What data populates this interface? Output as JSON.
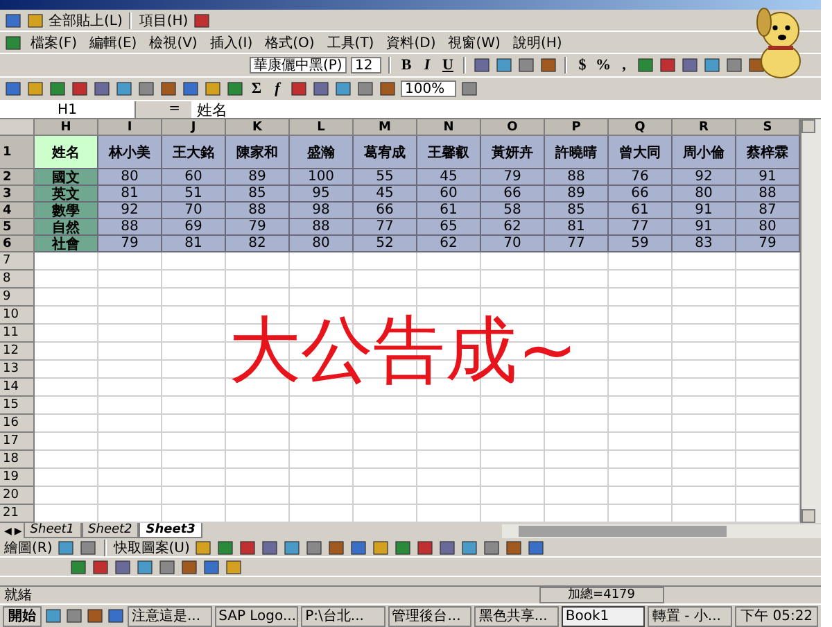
{
  "clipboard_bar": {
    "items": [
      "全部貼上(L)",
      "項目(H)"
    ]
  },
  "menu": [
    "檔案(F)",
    "編輯(E)",
    "檢視(V)",
    "插入(I)",
    "格式(O)",
    "工具(T)",
    "資料(D)",
    "視窗(W)",
    "說明(H)"
  ],
  "format_toolbar": {
    "font": "華康儷中黑(P)",
    "size": "12",
    "style_buttons": [
      "B",
      "I",
      "U"
    ],
    "number_buttons": [
      "$",
      "%",
      ","
    ]
  },
  "standard_toolbar": {
    "symbols": [
      "Σ",
      "f"
    ],
    "zoom": "100%"
  },
  "formula_bar": {
    "name_box": "H1",
    "equals": "=",
    "content": "姓名"
  },
  "sheet": {
    "columns": [
      {
        "label": "H",
        "selected": true
      },
      {
        "label": "I",
        "selected": true
      },
      {
        "label": "J",
        "selected": true
      },
      {
        "label": "K",
        "selected": true
      },
      {
        "label": "L",
        "selected": true
      },
      {
        "label": "M",
        "selected": true
      },
      {
        "label": "N",
        "selected": true
      },
      {
        "label": "O",
        "selected": true
      },
      {
        "label": "P",
        "selected": true
      },
      {
        "label": "Q",
        "selected": true
      },
      {
        "label": "R",
        "selected": true
      },
      {
        "label": "S",
        "selected": true
      }
    ],
    "rows": [
      {
        "number": "1",
        "selected": true,
        "cells": [
          "姓名",
          "林小美",
          "王大銘",
          "陳家和",
          "盛瀚",
          "葛宥成",
          "王馨叡",
          "黃妍卉",
          "許曉晴",
          "曾大同",
          "周小倫",
          "蔡梓霖"
        ]
      },
      {
        "number": "2",
        "selected": true,
        "cells": [
          "國文",
          "80",
          "60",
          "89",
          "100",
          "55",
          "45",
          "79",
          "88",
          "76",
          "92",
          "91"
        ]
      },
      {
        "number": "3",
        "selected": true,
        "cells": [
          "英文",
          "81",
          "51",
          "85",
          "95",
          "45",
          "60",
          "66",
          "89",
          "66",
          "80",
          "88"
        ]
      },
      {
        "number": "4",
        "selected": true,
        "cells": [
          "數學",
          "92",
          "70",
          "88",
          "98",
          "66",
          "61",
          "58",
          "85",
          "61",
          "91",
          "87"
        ]
      },
      {
        "number": "5",
        "selected": true,
        "cells": [
          "自然",
          "88",
          "69",
          "79",
          "88",
          "77",
          "65",
          "62",
          "81",
          "77",
          "91",
          "80"
        ]
      },
      {
        "number": "6",
        "selected": true,
        "cells": [
          "社會",
          "79",
          "81",
          "82",
          "80",
          "52",
          "62",
          "70",
          "77",
          "59",
          "83",
          "79"
        ]
      },
      {
        "number": "7",
        "selected": false,
        "cells": []
      },
      {
        "number": "8",
        "selected": false,
        "cells": []
      },
      {
        "number": "9",
        "selected": false,
        "cells": []
      },
      {
        "number": "10",
        "selected": false,
        "cells": []
      },
      {
        "number": "11",
        "selected": false,
        "cells": []
      },
      {
        "number": "12",
        "selected": false,
        "cells": []
      },
      {
        "number": "13",
        "selected": false,
        "cells": []
      },
      {
        "number": "14",
        "selected": false,
        "cells": []
      },
      {
        "number": "15",
        "selected": false,
        "cells": []
      },
      {
        "number": "16",
        "selected": false,
        "cells": []
      },
      {
        "number": "17",
        "selected": false,
        "cells": []
      },
      {
        "number": "18",
        "selected": false,
        "cells": []
      },
      {
        "number": "19",
        "selected": false,
        "cells": []
      },
      {
        "number": "20",
        "selected": false,
        "cells": []
      },
      {
        "number": "21",
        "selected": false,
        "cells": []
      }
    ],
    "overlay_text": "大公告成~"
  },
  "sheet_nav": [
    "◀",
    "▶"
  ],
  "sheet_tabs": [
    {
      "label": "Sheet1",
      "selected": false
    },
    {
      "label": "Sheet2",
      "selected": false
    },
    {
      "label": "Sheet3",
      "selected": true
    }
  ],
  "drawing_toolbar": {
    "draw_menu": "繪圖(R)",
    "autoshapes_menu": "快取圖案(U)"
  },
  "status_bar": {
    "mode": "就緒",
    "sum": "加總=4179"
  },
  "taskbar": {
    "start": "開始",
    "tasks": [
      {
        "label": "注意這是...",
        "selected": false
      },
      {
        "label": "SAP Logo...",
        "selected": false
      },
      {
        "label": "P:\\台北...",
        "selected": false
      },
      {
        "label": "管理後台...",
        "selected": false
      },
      {
        "label": "黑色共享...",
        "selected": false
      },
      {
        "label": "Book1",
        "selected": true
      },
      {
        "label": "轉置 - 小...",
        "selected": false
      }
    ],
    "clock": "下午 05:22"
  }
}
